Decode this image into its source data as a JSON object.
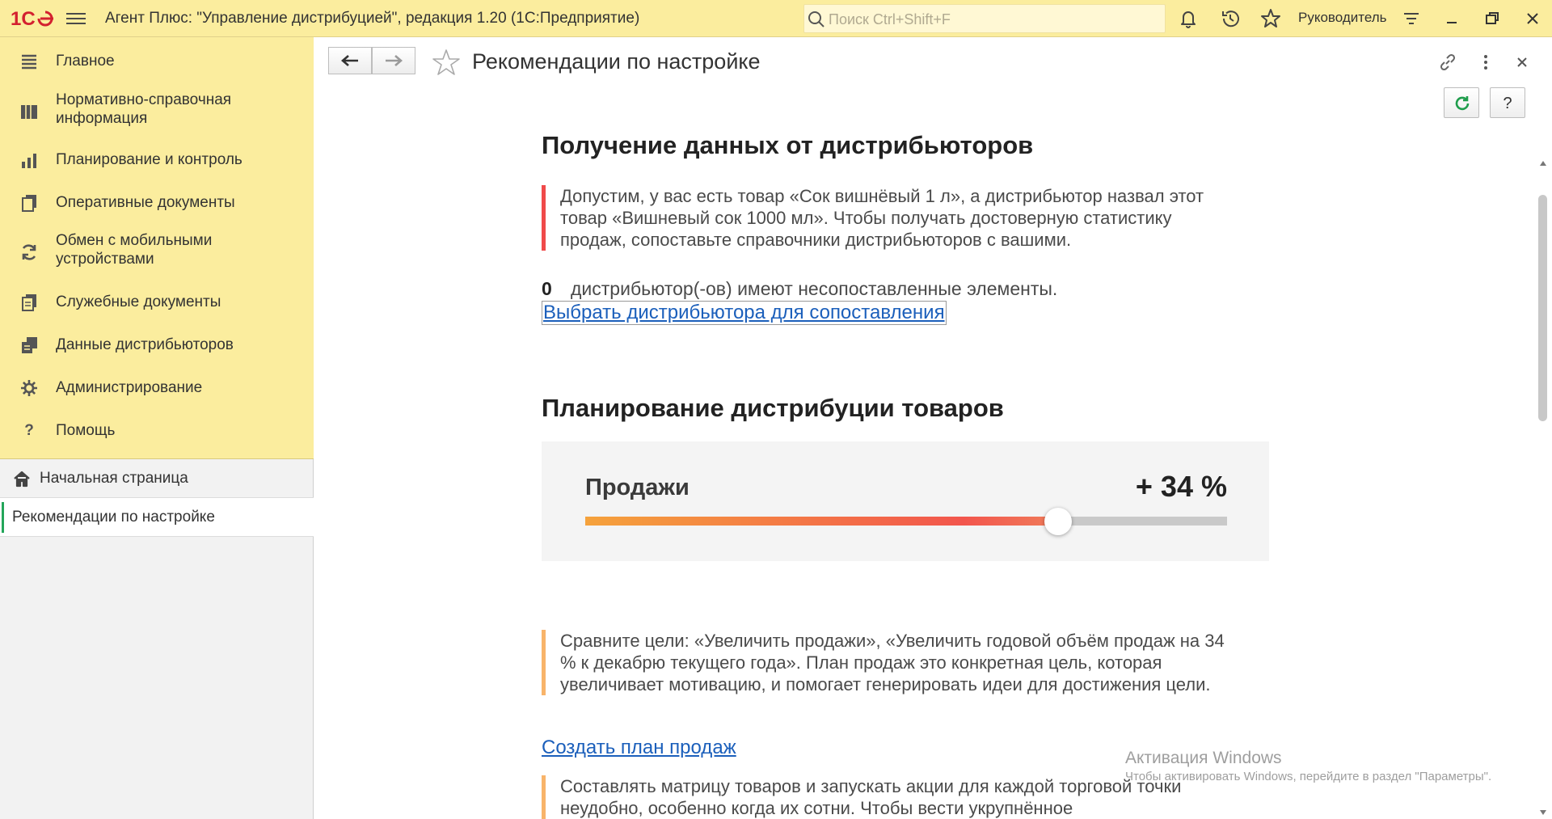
{
  "titlebar": {
    "logo_text": "1С",
    "app_title": "Агент Плюс: \"Управление дистрибуцией\", редакция 1.20  (1С:Предприятие)",
    "search_placeholder": "Поиск Ctrl+Shift+F",
    "user_name": "Руководитель",
    "icons": [
      "bell-icon",
      "history-icon",
      "star-icon",
      "settings-menu-icon",
      "minimize-icon",
      "restore-icon",
      "close-icon"
    ]
  },
  "sidebar": {
    "sections": [
      {
        "label": "Главное",
        "icon": "menu-lines-icon"
      },
      {
        "label": "Нормативно-справочная информация",
        "icon": "catalog-icon"
      },
      {
        "label": "Планирование и контроль",
        "icon": "bar-chart-icon"
      },
      {
        "label": "Оперативные документы",
        "icon": "documents-icon"
      },
      {
        "label": "Обмен с мобильными устройствами",
        "icon": "sync-icon"
      },
      {
        "label": "Служебные документы",
        "icon": "service-docs-icon"
      },
      {
        "label": "Данные дистрибьюторов",
        "icon": "distributor-data-icon"
      },
      {
        "label": "Администрирование",
        "icon": "gear-icon"
      },
      {
        "label": "Помощь",
        "icon": "question-icon"
      }
    ],
    "home_label": "Начальная страница",
    "open_form_label": "Рекомендации по настройке"
  },
  "form": {
    "title": "Рекомендации по настройке",
    "help_button": "?"
  },
  "section1": {
    "title": "Получение данных от дистрибьюторов",
    "note": "Допустим, у вас есть товар «Сок вишнёвый 1 л», а дистрибьютор назвал этот товар «Вишневый сок 1000 мл». Чтобы получать достоверную статистику продаж, сопоставьте справочники дистрибьюторов с вашими.",
    "count": "0",
    "count_text": "дистрибьютор(-ов) имеют несопоставленные элементы.",
    "link": "Выбрать дистрибьютора для сопоставления"
  },
  "section2": {
    "title": "Планирование дистрибуции товаров",
    "sales_label": "Продажи",
    "sales_value": "+ 34 %",
    "slider_fraction": 0.737,
    "note1": "Сравните цели: «Увеличить продажи», «Увеличить годовой объём продаж на 34 % к декабрю текущего года». План продаж это конкретная цель, которая увеличивает мотивацию, и помогает генерировать идеи для достижения цели.",
    "link": "Создать план продаж",
    "note2": "Составлять матрицу товаров и запускать акции для каждой торговой точки неудобно, особенно когда их сотни. Чтобы вести укрупнённое планирование продаж, заполните канал дистрибуции и формат у"
  },
  "watermark": {
    "title": "Активация Windows",
    "subtitle": "Чтобы активировать Windows, перейдите в раздел \"Параметры\"."
  },
  "colors": {
    "title_bar": "#fbed9e",
    "accent_red": "#f04a4a",
    "accent_orange": "#f8b46a",
    "link": "#1b5fbb",
    "active_marker": "#23a55a"
  }
}
